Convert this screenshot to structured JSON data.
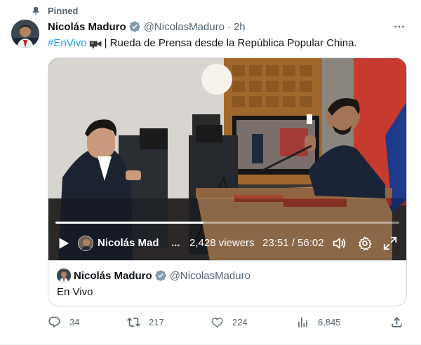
{
  "pinned_label": "Pinned",
  "author": {
    "name": "Nicolás Maduro",
    "handle": "@NicolasMaduro",
    "separator": "·",
    "time": "2h"
  },
  "tweet": {
    "hashtag": "#EnVivo",
    "text": "| Rueda de Prensa desde la República Popular China."
  },
  "video": {
    "channel_name": "Nicolás Mad",
    "channel_ellipsis": "...",
    "viewers": "2,428 viewers",
    "time": "23:51 / 56:02",
    "progress_fraction": 0.43
  },
  "quoted": {
    "name": "Nicolás Maduro",
    "handle": "@NicolasMaduro",
    "text": "En Vivo"
  },
  "actions": {
    "replies": "34",
    "reposts": "217",
    "likes": "224",
    "views": "6,845"
  },
  "colors": {
    "accent": "#1d9bf0",
    "secondary_text": "#536471",
    "verified_badge": "#829aab"
  },
  "icons": [
    "pin-icon",
    "verified-badge-icon",
    "more-icon",
    "video-camera-icon",
    "play-icon",
    "volume-icon",
    "settings-icon",
    "fullscreen-icon",
    "reply-icon",
    "repost-icon",
    "like-icon",
    "views-icon",
    "share-icon"
  ]
}
